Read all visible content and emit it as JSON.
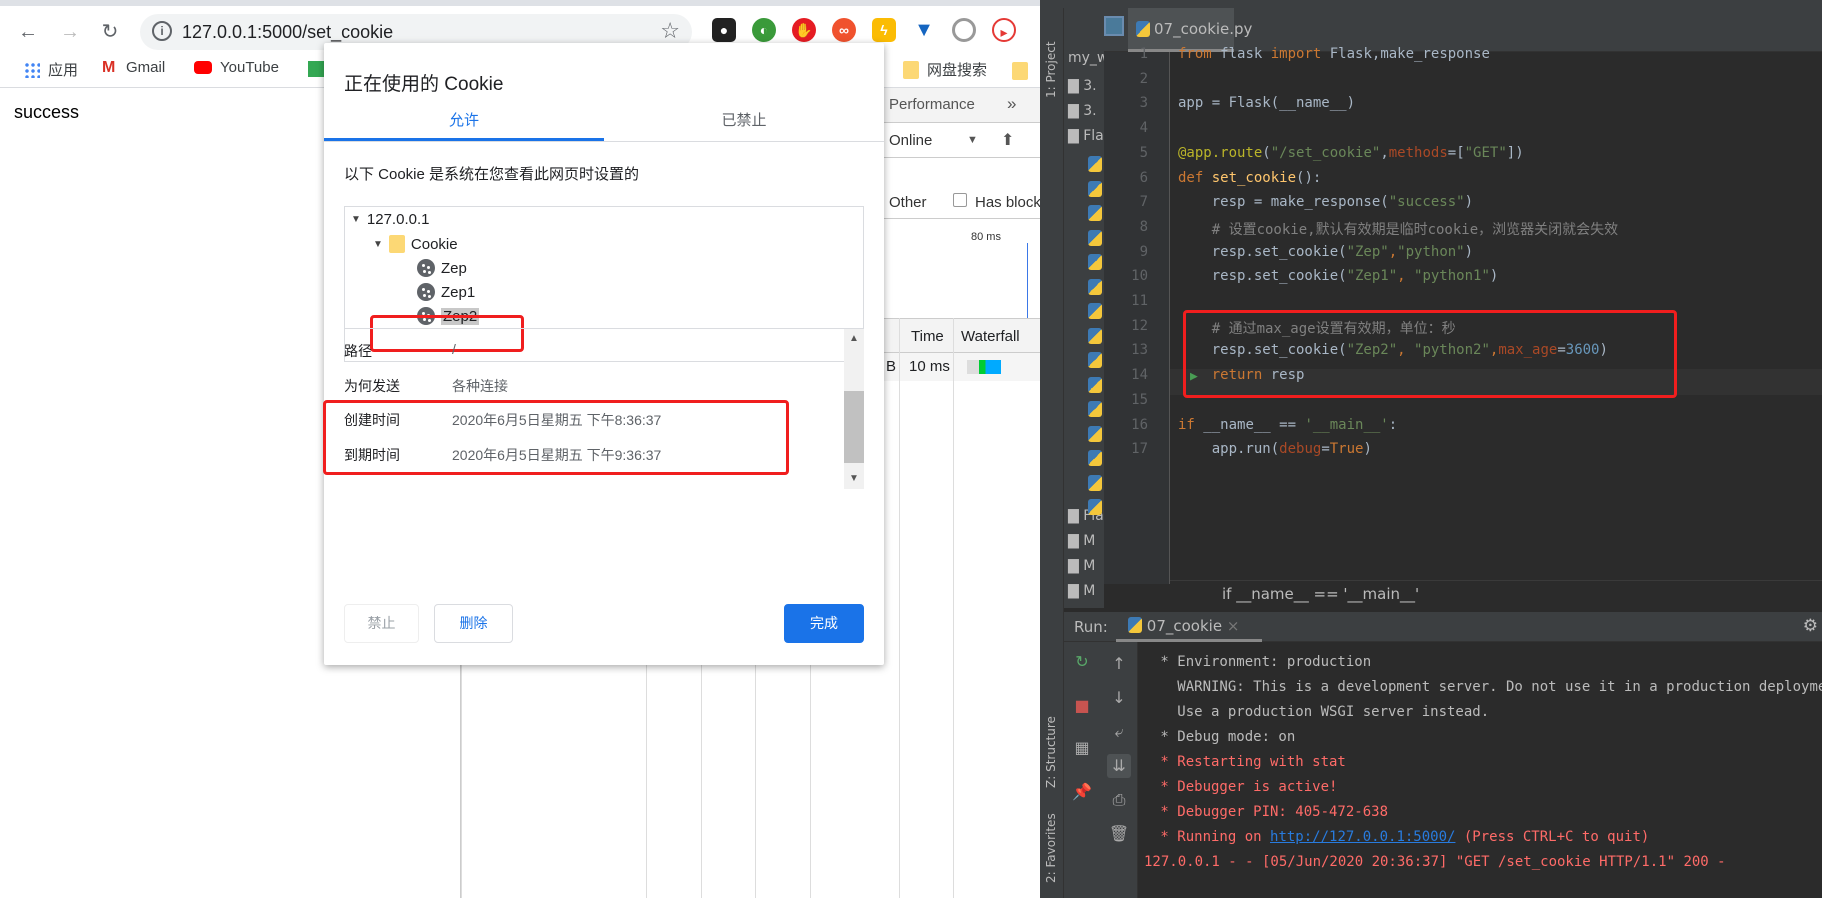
{
  "browser": {
    "url": "127.0.0.1:5000/set_cookie",
    "bookmarks": [
      "应用",
      "Gmail",
      "YouTube"
    ],
    "bookmark_right": "网盘搜索",
    "page_text": "success"
  },
  "devtools": {
    "tab": "Performance",
    "more": "»",
    "throttle": "Online",
    "filter_other": "Other",
    "has_blocked": "Has blocke",
    "overview_tick": "80 ms",
    "col_time": "Time",
    "col_waterfall": "Waterfall",
    "row_size": "B",
    "row_time": "10 ms"
  },
  "dialog": {
    "title": "正在使用的 Cookie",
    "tabs": [
      {
        "label": "允许",
        "active": true
      },
      {
        "label": "已禁止",
        "active": false
      }
    ],
    "description": "以下 Cookie 是系统在您查看此网页时设置的",
    "tree": {
      "host": "127.0.0.1",
      "folder": "Cookie",
      "cookies": [
        "Zep",
        "Zep1",
        "Zep2"
      ],
      "selected": "Zep2"
    },
    "details": [
      {
        "label": "路径",
        "value": "/"
      },
      {
        "label": "为何发送",
        "value": "各种连接"
      },
      {
        "label": "创建时间",
        "value": "2020年6月5日星期五 下午8:36:37"
      },
      {
        "label": "到期时间",
        "value": "2020年6月5日星期五 下午9:36:37"
      }
    ],
    "buttons": {
      "block": "禁止",
      "delete": "删除",
      "done": "完成"
    },
    "accent": "#1a73e8"
  },
  "ide": {
    "tool_project": "1: Project",
    "tool_structure": "Z: Structure",
    "tool_favorites": "2: Favorites",
    "project_items": [
      "my_w",
      "3.",
      "3.",
      "Fla",
      "Fla",
      "M",
      "M",
      "M"
    ],
    "file_tab": "07_cookie.py",
    "code": [
      [
        [
          "kw",
          "from "
        ],
        [
          "pl",
          "flask "
        ],
        [
          "kw",
          "import "
        ],
        [
          "pl",
          "Flask,make_response"
        ]
      ],
      [],
      [
        [
          "pl",
          "app = Flask(__name__)"
        ]
      ],
      [],
      [
        [
          "dec",
          "@app.route"
        ],
        [
          "pl",
          "("
        ],
        [
          "str",
          "\"/set_cookie\""
        ],
        [
          "pl",
          ","
        ],
        [
          "prm",
          "methods"
        ],
        [
          "pl",
          "=["
        ],
        [
          "str",
          "\"GET\""
        ],
        [
          "pl",
          "])"
        ]
      ],
      [
        [
          "kw",
          "def "
        ],
        [
          "fn",
          "set_cookie"
        ],
        [
          "pl",
          "():"
        ]
      ],
      [
        [
          "pl",
          "    resp = make_response("
        ],
        [
          "str",
          "\"success\""
        ],
        [
          "pl",
          ")"
        ]
      ],
      [
        [
          "cm",
          "    # 设置cookie,默认有效期是临时cookie，浏览器关闭就会失效"
        ]
      ],
      [
        [
          "pl",
          "    resp.set_cookie("
        ],
        [
          "str",
          "\"Zep\""
        ],
        [
          "kw",
          ","
        ],
        [
          "str",
          "\"python\""
        ],
        [
          "pl",
          ")"
        ]
      ],
      [
        [
          "pl",
          "    resp.set_cookie("
        ],
        [
          "str",
          "\"Zep1\""
        ],
        [
          "kw",
          ", "
        ],
        [
          "str",
          "\"python1\""
        ],
        [
          "pl",
          ")"
        ]
      ],
      [],
      [
        [
          "cm",
          "    # 通过max_age设置有效期，单位：秒"
        ]
      ],
      [
        [
          "pl",
          "    resp.set_cookie("
        ],
        [
          "str",
          "\"Zep2\""
        ],
        [
          "kw",
          ", "
        ],
        [
          "str",
          "\"python2\""
        ],
        [
          "kw",
          ","
        ],
        [
          "prm",
          "max_age"
        ],
        [
          "pl",
          "="
        ],
        [
          "num",
          "3600"
        ],
        [
          "pl",
          ")"
        ]
      ],
      [
        [
          "kw",
          "    return "
        ],
        [
          "pl",
          "resp"
        ]
      ],
      [],
      [
        [
          "kw",
          "if "
        ],
        [
          "pl",
          "__name__ == "
        ],
        [
          "str",
          "'__main__'"
        ],
        [
          "pl",
          ":"
        ]
      ],
      [
        [
          "pl",
          "    app.run("
        ],
        [
          "prm",
          "debug"
        ],
        [
          "pl",
          "="
        ],
        [
          "kw",
          "True"
        ],
        [
          "pl",
          ")"
        ]
      ]
    ],
    "breadcrumb": "if __name__ == '__main__'",
    "run_label": "Run:",
    "run_tab": "07_cookie",
    "console": [
      {
        "style": "white",
        "text": " * Environment: production"
      },
      {
        "style": "white",
        "text": "   WARNING: This is a development server. Do not use it in a production deployment."
      },
      {
        "style": "white",
        "text": "   Use a production WSGI server instead."
      },
      {
        "style": "white",
        "text": " * Debug mode: on"
      },
      {
        "style": "red",
        "text": " * Restarting with stat"
      },
      {
        "style": "red",
        "text": " * Debugger is active!"
      },
      {
        "style": "red",
        "text": " * Debugger PIN: 405-472-638"
      },
      {
        "style": "red",
        "text": " * Running on ",
        "link": "http://127.0.0.1:5000/",
        "after": " (Press CTRL+C to quit)"
      },
      {
        "style": "red",
        "text": "127.0.0.1 - - [05/Jun/2020 20:36:37] \"GET /set_cookie HTTP/1.1\" 200 -"
      }
    ]
  }
}
